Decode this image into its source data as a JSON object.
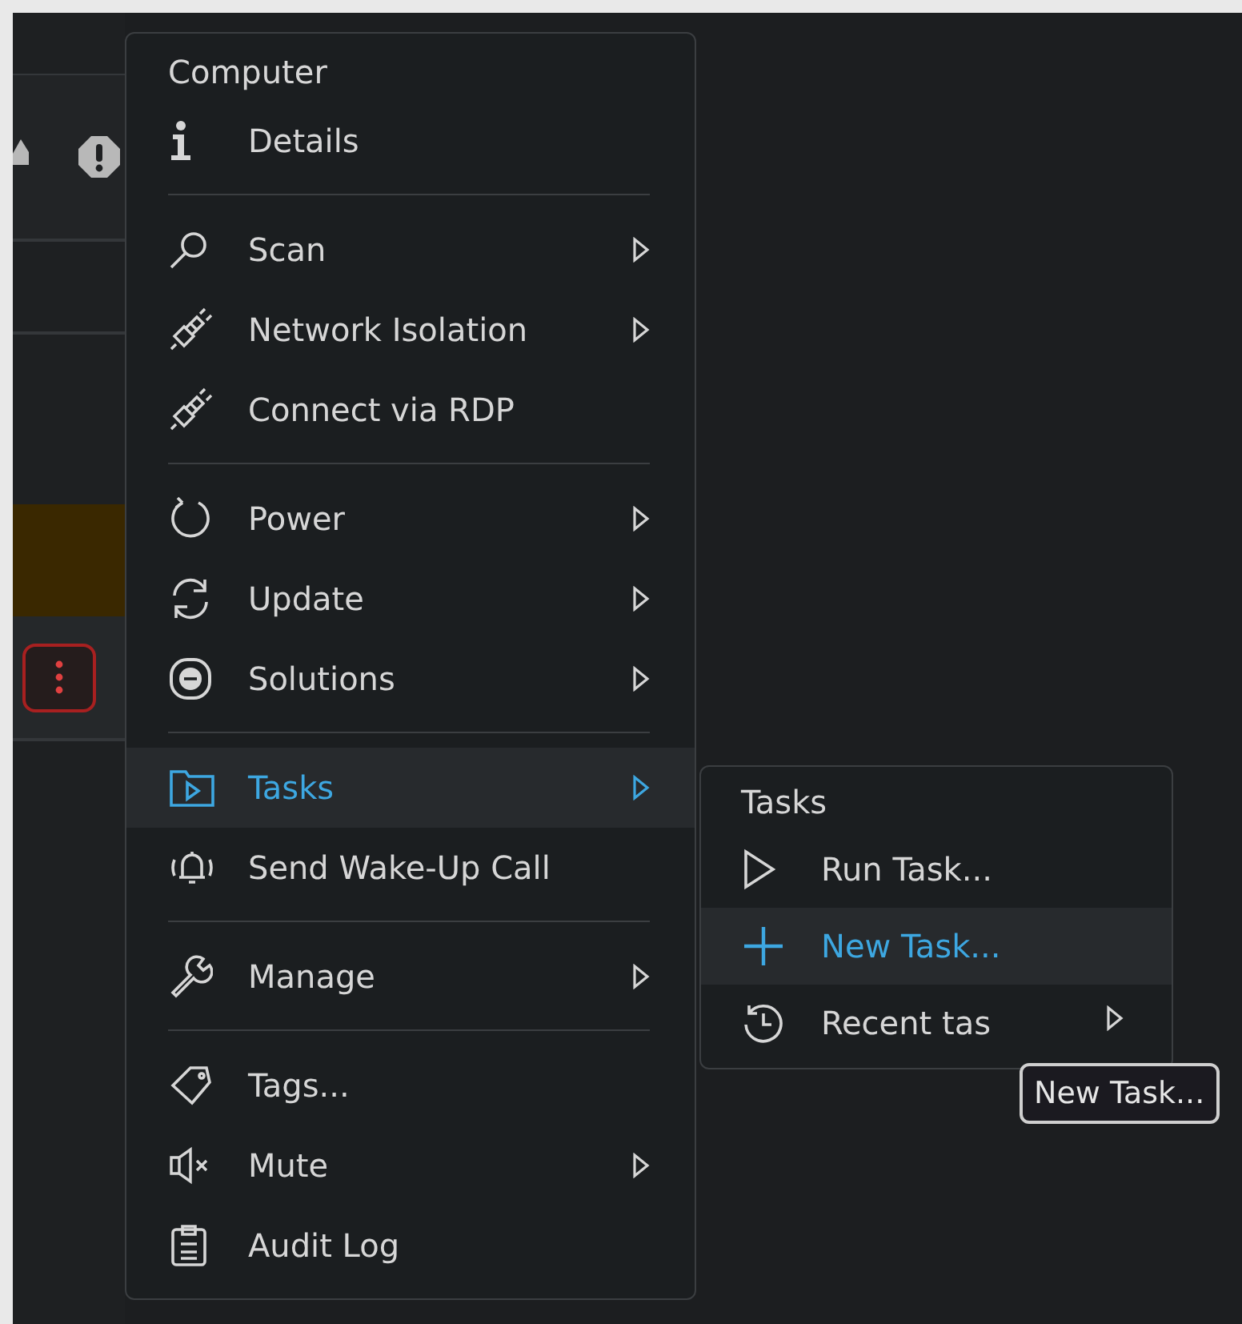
{
  "menu": {
    "title": "Computer",
    "items": [
      {
        "kind": "item",
        "label": "Details",
        "submenu": false,
        "selected": false
      },
      {
        "kind": "separator"
      },
      {
        "kind": "item",
        "label": "Scan",
        "submenu": true,
        "selected": false
      },
      {
        "kind": "item",
        "label": "Network Isolation",
        "submenu": true,
        "selected": false
      },
      {
        "kind": "item",
        "label": "Connect via RDP",
        "submenu": false,
        "selected": false
      },
      {
        "kind": "separator"
      },
      {
        "kind": "item",
        "label": "Power",
        "submenu": true,
        "selected": false
      },
      {
        "kind": "item",
        "label": "Update",
        "submenu": true,
        "selected": false
      },
      {
        "kind": "item",
        "label": "Solutions",
        "submenu": true,
        "selected": false
      },
      {
        "kind": "separator"
      },
      {
        "kind": "item",
        "label": "Tasks",
        "submenu": true,
        "selected": true
      },
      {
        "kind": "item",
        "label": "Send Wake-Up Call",
        "submenu": false,
        "selected": false
      },
      {
        "kind": "separator"
      },
      {
        "kind": "item",
        "label": "Manage",
        "submenu": true,
        "selected": false
      },
      {
        "kind": "separator"
      },
      {
        "kind": "item",
        "label": "Tags...",
        "submenu": false,
        "selected": false
      },
      {
        "kind": "item",
        "label": "Mute",
        "submenu": true,
        "selected": false
      },
      {
        "kind": "item",
        "label": "Audit Log",
        "submenu": false,
        "selected": false
      }
    ]
  },
  "submenu": {
    "title": "Tasks",
    "items": [
      {
        "label": "Run Task...",
        "submenu": false,
        "selected": false
      },
      {
        "label": "New Task...",
        "submenu": false,
        "selected": true
      },
      {
        "label": "Recent tas",
        "submenu": true,
        "selected": false
      }
    ]
  },
  "tooltip": {
    "text": "New Task..."
  }
}
